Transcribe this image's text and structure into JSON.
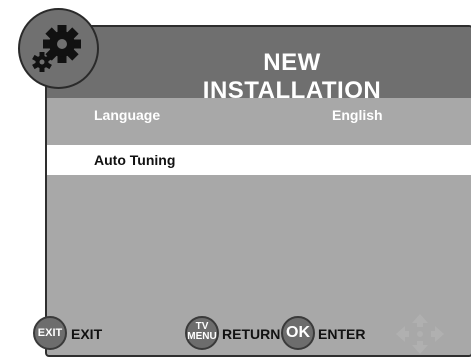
{
  "menu": {
    "title": "NEW INSTALLATION",
    "items": [
      {
        "label": "Language",
        "value": "English",
        "selected": false
      },
      {
        "label": "Auto Tuning",
        "value": "",
        "selected": true
      }
    ]
  },
  "footer": {
    "exit": {
      "button_text": "EXIT",
      "label": "EXIT"
    },
    "return": {
      "button_text_line1": "TV",
      "button_text_line2": "MENU",
      "label": "RETURN"
    },
    "enter": {
      "button_text": "OK",
      "label": "ENTER"
    }
  },
  "icons": {
    "header_icon": "gear-icon",
    "navigation_icon": "dpad-arrows-icon"
  },
  "colors": {
    "panel_body": "#a8a8a8",
    "header_bar": "#6f6f6f",
    "selected_row": "#ffffff",
    "button_fill": "#6d6d6d"
  }
}
